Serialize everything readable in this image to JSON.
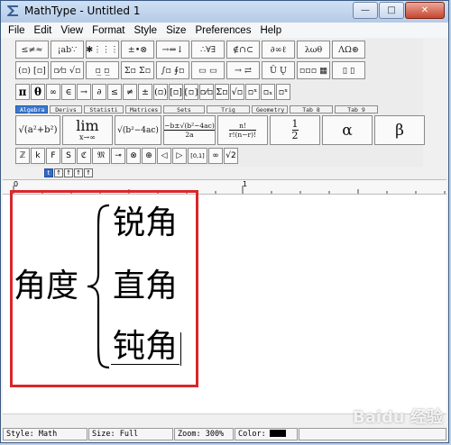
{
  "window": {
    "title": "MathType - Untitled 1",
    "controls": {
      "minimize": "—",
      "maximize": "□",
      "close": "✕"
    }
  },
  "menu": [
    "File",
    "Edit",
    "View",
    "Format",
    "Style",
    "Size",
    "Preferences",
    "Help"
  ],
  "toolbar": {
    "row1": [
      "≤≠≈",
      "¡ab∵",
      "✱⋮⋮⋮",
      "±•⊗",
      "→⇔↓",
      "∴∀∃",
      "∉∩⊂",
      "∂∞ℓ",
      "λωθ",
      "ΛΩ⊛"
    ],
    "row2": [
      "(▫) [▫]",
      "▫⁄▫ √▫",
      "▫̲ ▫̲",
      "Σ▫ Σ▫",
      "∫▫ ∮▫",
      "▭ ▭",
      "→ ⇄",
      "Ū Ų",
      "▫▫▫ ▦",
      "▯ ▯"
    ],
    "row3": [
      "π",
      "θ",
      "∞",
      "∈",
      "→",
      "∂",
      "≤",
      "≠",
      "±",
      "(▫)",
      "[▫]",
      "{▫}",
      "▫⁄▫",
      "Σ▫",
      "√▫",
      "▫ˣ",
      "▫ₓ",
      "▫ˣ"
    ],
    "tabs": [
      "Algebra",
      "Derivs",
      "Statisti",
      "Matrices",
      "Sets",
      "Trig",
      "Geometry",
      "Tab 8",
      "Tab 9"
    ],
    "templates": {
      "sqrt_sum": "√(a²+b²)",
      "lim_main": "lim",
      "lim_sub": "x→∞",
      "sqrt_b": "√(b²−4ac)",
      "quad_num": "−b±√(b²−4ac)",
      "quad_den": "2a",
      "comb_num": "n!",
      "comb_den": "r!(n−r)!",
      "half_num": "1",
      "half_den": "2",
      "alpha": "α",
      "beta": "β"
    },
    "row5": [
      "ℤ",
      "k",
      "F",
      "S",
      "ℭ",
      "𝔐",
      "⊸",
      "⊗",
      "⊕",
      "◁",
      "▷",
      "[0,1]",
      "∞",
      "√2"
    ],
    "mini_buttons": [
      "t",
      "↑",
      "↑",
      "↑",
      "↑"
    ]
  },
  "ruler": {
    "labels": [
      "0",
      "1"
    ]
  },
  "editor": {
    "left_term": "角度",
    "items": [
      "锐角",
      "直角",
      "钝角"
    ]
  },
  "watermark": "Baidu 经验",
  "status": {
    "style": "Style: Math",
    "size": "Size: Full",
    "zoom": "Zoom: 300%",
    "color_label": "Color:",
    "color_value": "#000000"
  },
  "colors": {
    "highlight_border": "#d8282c",
    "active_tab": "#3a78d0",
    "title_gradient_top": "#cfe0f4"
  }
}
